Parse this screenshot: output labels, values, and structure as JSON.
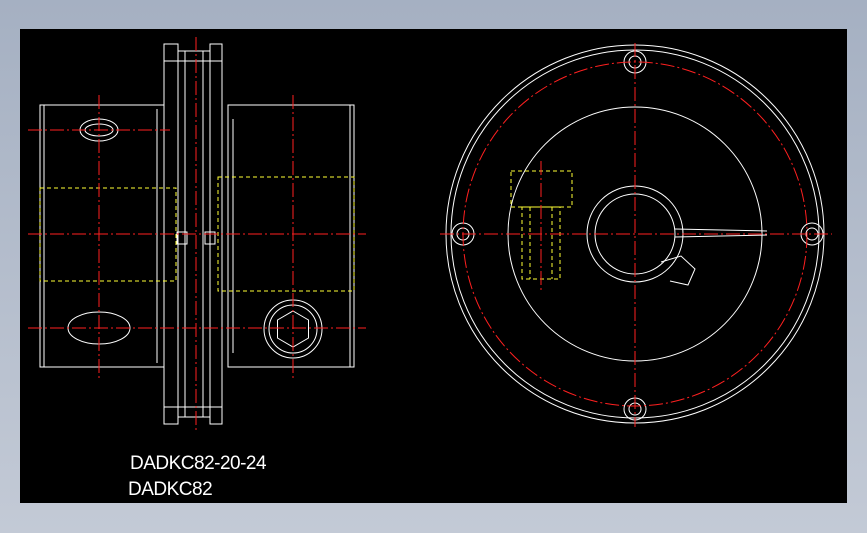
{
  "drawing": {
    "part_number": "DADKC82-20-24",
    "model": "DADKC82"
  },
  "colors": {
    "background_outer": "#b4bccb",
    "canvas": "#000000",
    "outline": "#ffffff",
    "centerline": "#ff2020",
    "hidden_line": "#ffff33",
    "text": "#ffffff"
  }
}
